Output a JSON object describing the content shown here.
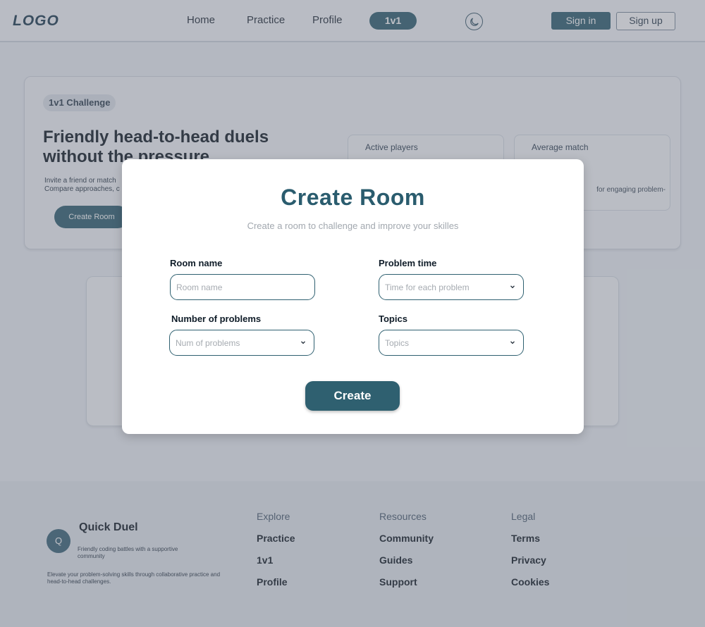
{
  "nav": {
    "logo": "LOGO",
    "links": [
      "Home",
      "Practice",
      "Profile"
    ],
    "active_pill": "1v1",
    "theme_icon": "moon-icon",
    "sign_in": "Sign in",
    "sign_up": "Sign up"
  },
  "hero": {
    "badge": "1v1 Challenge",
    "title": "Friendly head-to-head duels without the pressure",
    "description_line1": "Invite a friend or match",
    "description_line2": "Compare approaches, c",
    "cta": "Create Room",
    "stats": [
      {
        "label": "Active players",
        "note": ""
      },
      {
        "label": "Average match",
        "note": "for engaging problem-"
      }
    ]
  },
  "modal": {
    "title": "Create Room",
    "subtitle": "Create a room to challenge and improve your skilles",
    "fields": {
      "room_name": {
        "label": "Room name",
        "placeholder": "Room name"
      },
      "problem_time": {
        "label": "Problem time",
        "placeholder": "Time for each problem"
      },
      "num_problems": {
        "label": "Number of problems",
        "placeholder": "Num of problems"
      },
      "topics": {
        "label": "Topics",
        "placeholder": "Topics"
      }
    },
    "create_button": "Create"
  },
  "footer": {
    "brand_initial": "Q",
    "brand_name": "Quick Duel",
    "tagline": "Friendly coding battles with a supportive community",
    "description": "Elevate your problem-solving skills through collaborative practice and head-to-head challenges.",
    "columns": [
      {
        "heading": "Explore",
        "links": [
          "Practice",
          "1v1",
          "Profile"
        ]
      },
      {
        "heading": "Resources",
        "links": [
          "Community",
          "Guides",
          "Support"
        ]
      },
      {
        "heading": "Legal",
        "links": [
          "Terms",
          "Privacy",
          "Cookies"
        ]
      }
    ]
  },
  "colors": {
    "primary": "#2f6070",
    "title": "#2a5c6e",
    "overlay": "#646a76"
  }
}
